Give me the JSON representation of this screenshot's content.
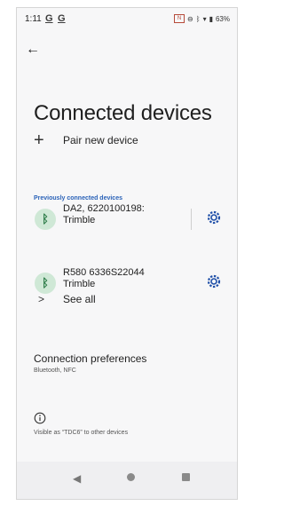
{
  "status_bar": {
    "time": "1:11",
    "notif1": "G",
    "notif2": "G",
    "battery": "63%"
  },
  "header": {
    "back_icon": "arrow-left-icon",
    "title": "Connected devices"
  },
  "pair": {
    "label": "Pair new device",
    "icon": "plus-icon"
  },
  "section_header": "Previously connected devices",
  "devices": [
    {
      "name": "DA2, 6220100198:\nTrimble",
      "line1": "DA2, 6220100198:",
      "line2": "Trimble",
      "icon": "bluetooth-icon",
      "settings_icon": "gear-icon"
    },
    {
      "name": "R580 6336S22044\nTrimble",
      "line1": "R580 6336S22044",
      "line2": "Trimble",
      "icon": "bluetooth-connected-icon",
      "settings_icon": "gear-icon"
    }
  ],
  "see_all": {
    "label": "See all",
    "icon": "chevron-right-icon"
  },
  "connection_preferences": {
    "title": "Connection preferences",
    "subtitle": "Bluetooth, NFC"
  },
  "info": {
    "icon": "info-icon",
    "text": "Visible as “TDC6” to other devices"
  },
  "nav": {
    "back": "back-icon",
    "home": "home-icon",
    "recents": "recents-icon"
  },
  "colors": {
    "accent": "#2a62b8",
    "bt_bg": "#cfe8d6",
    "bt_fg": "#2f7d4a",
    "gear": "#1f4fa8"
  }
}
